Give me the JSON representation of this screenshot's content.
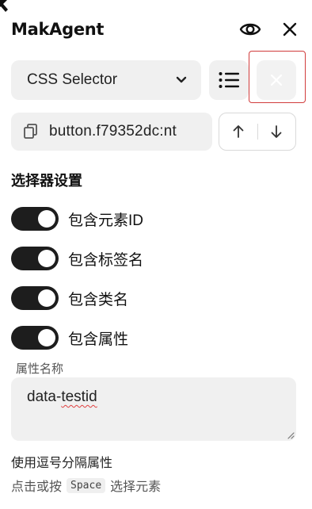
{
  "header": {
    "title": "MakAgent"
  },
  "selector_mode": {
    "value": "CSS Selector"
  },
  "selector_field": {
    "value": "button.f79352dc:nt"
  },
  "settings": {
    "title": "选择器设置",
    "toggles": [
      {
        "label": "包含元素ID",
        "on": true
      },
      {
        "label": "包含标签名",
        "on": true
      },
      {
        "label": "包含类名",
        "on": true
      },
      {
        "label": "包含属性",
        "on": true
      }
    ]
  },
  "attribute_field": {
    "label": "属性名称",
    "value_prefix": "data-",
    "value_misspelled": "testid"
  },
  "hint": "使用逗号分隔属性",
  "footer": {
    "before": "点击或按",
    "key": "Space",
    "after": "选择元素"
  },
  "colors": {
    "toggle_on": "#1d1d1d",
    "highlight_outline": "#d13c3c",
    "field_bg": "#f0f0f0"
  }
}
